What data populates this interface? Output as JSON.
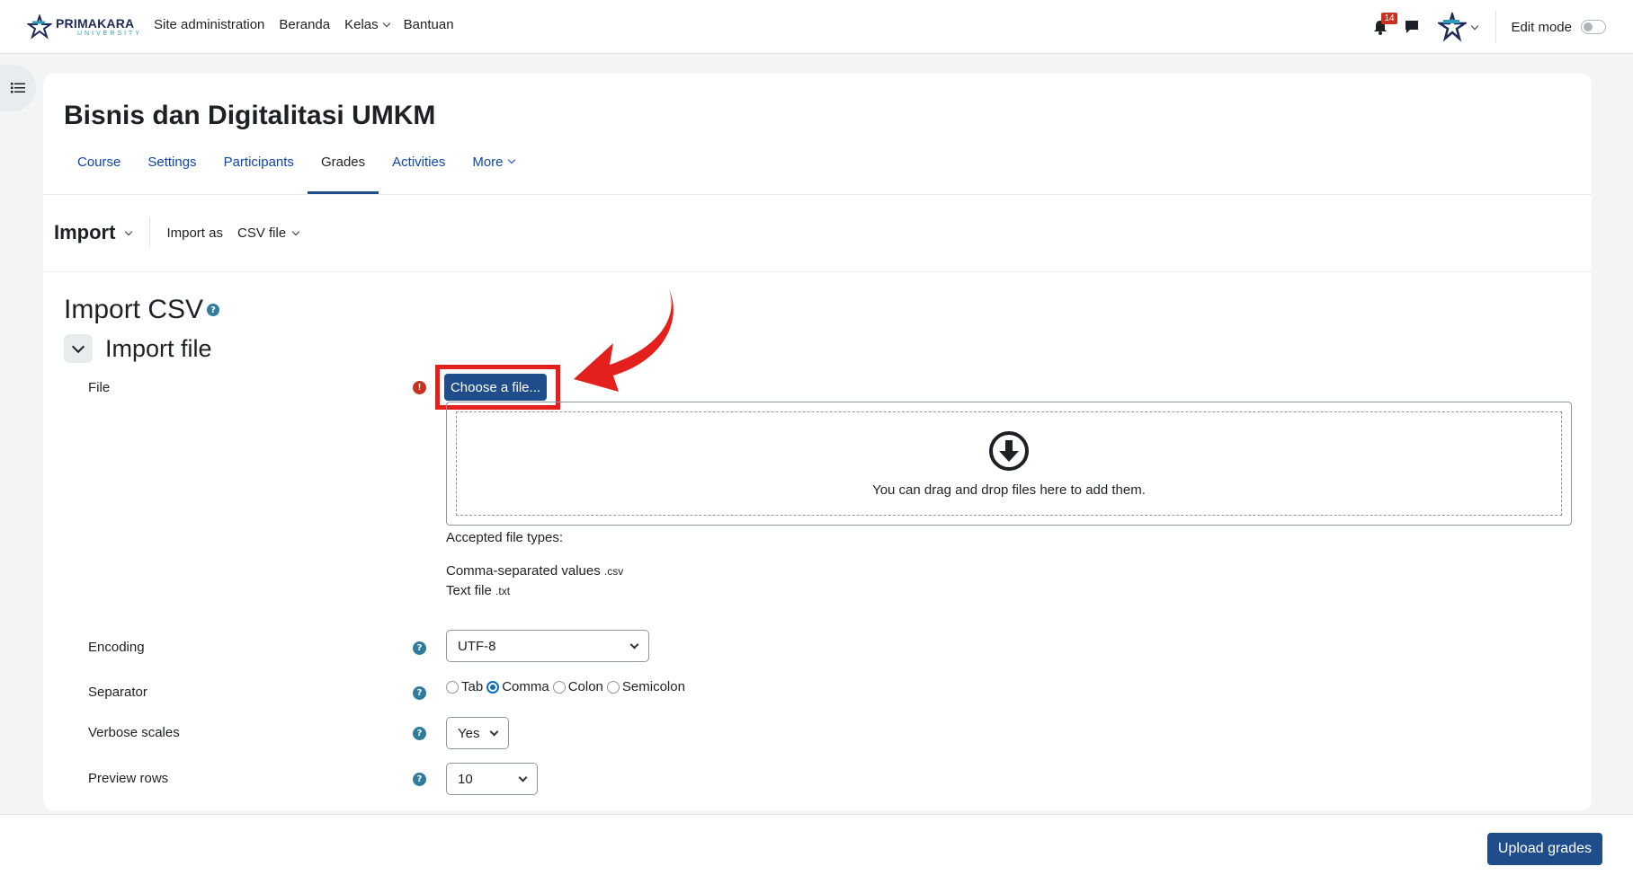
{
  "brand": {
    "name": "PRIMAKARA",
    "sub": "UNIVERSITY"
  },
  "nav": {
    "site_admin": "Site administration",
    "beranda": "Beranda",
    "kelas": "Kelas",
    "bantuan": "Bantuan",
    "notification_count": "14",
    "edit_mode": "Edit mode"
  },
  "course": {
    "title": "Bisnis dan Digitalitasi UMKM",
    "tabs": [
      "Course",
      "Settings",
      "Participants",
      "Grades",
      "Activities",
      "More"
    ],
    "active_tab": "Grades"
  },
  "tertiary": {
    "import_label": "Import",
    "import_as_label": "Import as",
    "import_as_value": "CSV file"
  },
  "form": {
    "heading": "Import CSV",
    "section": "Import file",
    "file_label": "File",
    "choose_button": "Choose a file...",
    "dropzone_msg": "You can drag and drop files here to add them.",
    "accepted_title": "Accepted file types:",
    "accepted": [
      {
        "name": "Comma-separated values",
        "ext": ".csv"
      },
      {
        "name": "Text file",
        "ext": ".txt"
      }
    ],
    "encoding_label": "Encoding",
    "encoding_value": "UTF-8",
    "separator_label": "Separator",
    "separator_options": [
      "Tab",
      "Comma",
      "Colon",
      "Semicolon"
    ],
    "separator_selected": "Comma",
    "verbose_label": "Verbose scales",
    "verbose_value": "Yes",
    "preview_label": "Preview rows",
    "preview_value": "10"
  },
  "footer": {
    "upload_button": "Upload grades"
  },
  "colors": {
    "primary": "#1f4d8c",
    "link": "#0f47ad",
    "highlight": "#e3201b",
    "required": "#ca3120",
    "help": "#2f7c9d"
  }
}
